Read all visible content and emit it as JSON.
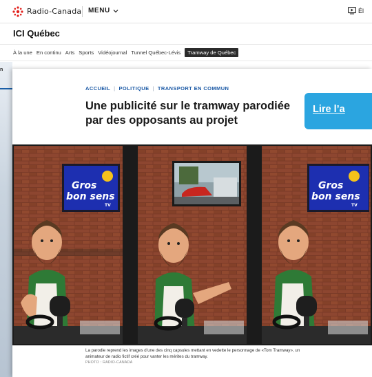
{
  "header": {
    "logo_text": "Radio-Canada",
    "menu_label": "MENU",
    "tv_label": "Él"
  },
  "section": {
    "title": "ICI Québec"
  },
  "nav": {
    "items": [
      "À la une",
      "En continu",
      "Arts",
      "Sports",
      "Vidéojournal",
      "Tunnel Québec-Lévis"
    ],
    "active": "Tramway de Québec"
  },
  "left_fragment": {
    "text": "n"
  },
  "article": {
    "breadcrumb": [
      "ACCUEIL",
      "POLITIQUE",
      "TRANSPORT EN COMMUN"
    ],
    "breadcrumb_separator": "|",
    "title": "Une publicité sur le tramway parodiée par des opposants au projet",
    "read_button": "Lire l’a",
    "image": {
      "panel_1_tv_line1": "Gros",
      "panel_1_tv_line2": "bon sens",
      "panel_1_tv_line3": "TV",
      "panel_3_tv_line1": "Gros",
      "panel_3_tv_line2": "bon sens",
      "panel_3_tv_line3": "TV"
    },
    "caption": "La parodie reprend les images d’une des cinq capsules mettant en vedette le personnage de «Tom Tramway», un animateur de radio fictif créé pour vanter les mérites du tramway.",
    "credit": "PHOTO : RADIO-CANADA"
  },
  "colors": {
    "brand_red": "#e2211c",
    "link_blue": "#1c5aa6",
    "cta_blue": "#2ba5e0"
  }
}
